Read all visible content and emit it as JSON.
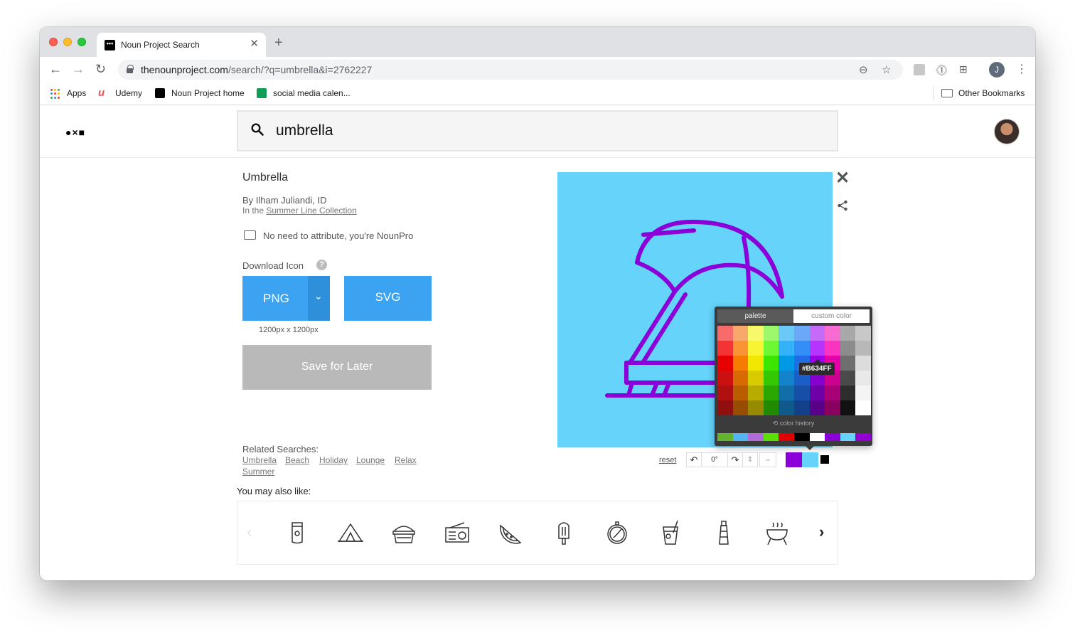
{
  "browser": {
    "tab_title": "Noun Project Search",
    "tab_favicon": "•••",
    "new_tab": "+",
    "url_domain": "thenounproject.com",
    "url_path": "/search/?q=umbrella&i=2762227",
    "profile_initial": "J",
    "bookmarks": [
      {
        "label": "Apps",
        "icon": "apps-grid-icon"
      },
      {
        "label": "Udemy",
        "icon": "udemy-icon"
      },
      {
        "label": "Noun Project home",
        "icon": "noun-project-icon"
      },
      {
        "label": "social media calen...",
        "icon": "google-sheets-icon"
      }
    ],
    "other_bookmarks": "Other Bookmarks"
  },
  "site": {
    "logo": "●×■",
    "search_query": "umbrella"
  },
  "detail": {
    "title": "Umbrella",
    "byline": "By Ilham Juliandi, ID",
    "collection_prefix": "In the ",
    "collection_link": "Summer Line Collection",
    "attribution": "No need to attribute, you're NounPro",
    "download_label": "Download Icon",
    "help": "?",
    "png_label": "PNG",
    "svg_label": "SVG",
    "size": "1200px x 1200px",
    "save_label": "Save for Later",
    "related_label": "Related Searches:",
    "related": [
      "Umbrella",
      "Beach",
      "Holiday",
      "Lounge",
      "Relax",
      "Summer"
    ],
    "also_like": "You may also like:"
  },
  "carousel": {
    "items": [
      "sunscreen-icon",
      "tent-icon",
      "picnic-basket-icon",
      "radio-icon",
      "watermelon-icon",
      "popsicle-icon",
      "compass-icon",
      "drink-icon",
      "lighthouse-icon",
      "grill-icon"
    ]
  },
  "preview": {
    "background": "#66d3fa",
    "icon_color": "#8b00d9"
  },
  "picker": {
    "tab_palette": "palette",
    "tab_custom": "custom color",
    "hex_tooltip": "#B634FF",
    "history_label": "color history",
    "swatches": [
      "#f86b6b",
      "#f8a86b",
      "#f8f86b",
      "#9ef86b",
      "#6bc9f8",
      "#6ba8f8",
      "#c46bf8",
      "#f86bd1",
      "#a8a8a8",
      "#c8c8c8",
      "#f43434",
      "#f89434",
      "#f8f434",
      "#6ef834",
      "#34b2f8",
      "#348ef8",
      "#b634ff",
      "#f834c1",
      "#8c8c8c",
      "#b8b8b8",
      "#e60000",
      "#f57c00",
      "#f0e800",
      "#3ce600",
      "#0099e6",
      "#1f6ee6",
      "#9c00e6",
      "#e600a8",
      "#6f6f6f",
      "#dcdcdc",
      "#cc1010",
      "#d76a00",
      "#d8cc00",
      "#33c800",
      "#1384cc",
      "#1b5ec8",
      "#8400cc",
      "#cc008f",
      "#4a4a4a",
      "#e9e9e9",
      "#b01010",
      "#b95c00",
      "#b8ac00",
      "#2ba800",
      "#116ea8",
      "#174ea8",
      "#6e00a8",
      "#a80077",
      "#2d2d2d",
      "#f4f4f4",
      "#901010",
      "#984c00",
      "#968a00",
      "#228a00",
      "#0f5a8a",
      "#14408a",
      "#58008a",
      "#8a0061",
      "#111111",
      "#ffffff"
    ],
    "history": [
      "#63b32e",
      "#55b5f2",
      "#b06bd9",
      "#59e000",
      "#e00000",
      "#000000",
      "#ffffff",
      "#8b00d9",
      "#66d3fa",
      "#9400d3"
    ]
  },
  "controls": {
    "reset": "reset",
    "rotation": "0°",
    "colors": [
      "#8b00d9",
      "#66d3fa",
      "#000000"
    ]
  }
}
